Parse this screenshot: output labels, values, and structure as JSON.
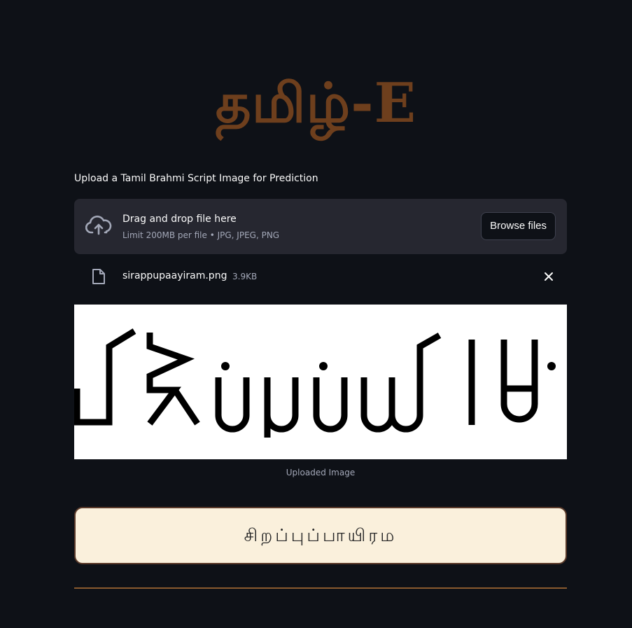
{
  "app": {
    "title": "தமிழ்-E"
  },
  "uploader": {
    "label": "Upload a Tamil Brahmi Script Image for Prediction",
    "drop_title": "Drag and drop file here",
    "drop_limit": "Limit 200MB per file • JPG, JPEG, PNG",
    "browse_label": "Browse files",
    "icon": "cloud-upload-icon"
  },
  "file": {
    "name": "sirappupaayiram.png",
    "size": "3.9KB",
    "icon": "file-icon",
    "remove_icon": "close-icon"
  },
  "image": {
    "caption": "Uploaded Image"
  },
  "result": {
    "text": "சிறப்புப்பாயிரம"
  },
  "colors": {
    "background": "#0e1117",
    "title": "#6e3f1d",
    "dropzone": "#262730",
    "result_bg": "#faf0dc",
    "result_border": "#5a3a2a",
    "divider": "#8a5a2e"
  }
}
